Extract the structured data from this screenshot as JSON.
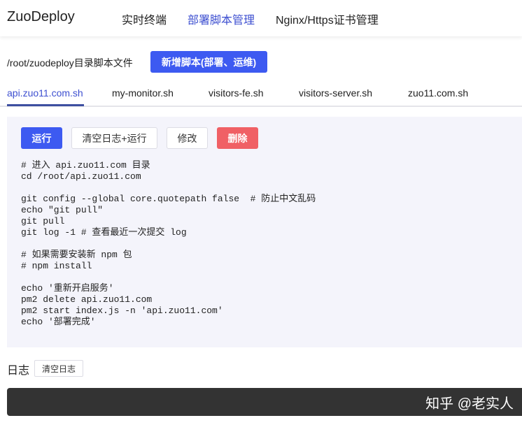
{
  "header": {
    "logo": "ZuoDeploy",
    "nav": [
      {
        "label": "实时终端"
      },
      {
        "label": "部署脚本管理",
        "active": true
      },
      {
        "label": "Nginx/Https证书管理"
      }
    ]
  },
  "toolbar": {
    "path": "/root/zuodeploy目录脚本文件",
    "add_label": "新增脚本(部署、运维)"
  },
  "tabs": [
    {
      "label": "api.zuo11.com.sh",
      "active": true
    },
    {
      "label": "my-monitor.sh"
    },
    {
      "label": "visitors-fe.sh"
    },
    {
      "label": "visitors-server.sh"
    },
    {
      "label": "zuo11.com.sh"
    }
  ],
  "actions": {
    "run": "运行",
    "clear_run": "清空日志+运行",
    "edit": "修改",
    "delete": "删除"
  },
  "script": "# 进入 api.zuo11.com 目录\ncd /root/api.zuo11.com\n\ngit config --global core.quotepath false  # 防止中文乱码\necho \"git pull\"\ngit pull\ngit log -1 # 查看最近一次提交 log\n\n# 如果需要安装新 npm 包\n# npm install\n\necho '重新开启服务'\npm2 delete api.zuo11.com\npm2 start index.js -n 'api.zuo11.com'\necho '部署完成'",
  "log": {
    "label": "日志",
    "clear": "清空日志"
  },
  "watermark": "知乎 @老实人",
  "colors": {
    "accent": "#3d5af1",
    "danger": "#f06065"
  }
}
